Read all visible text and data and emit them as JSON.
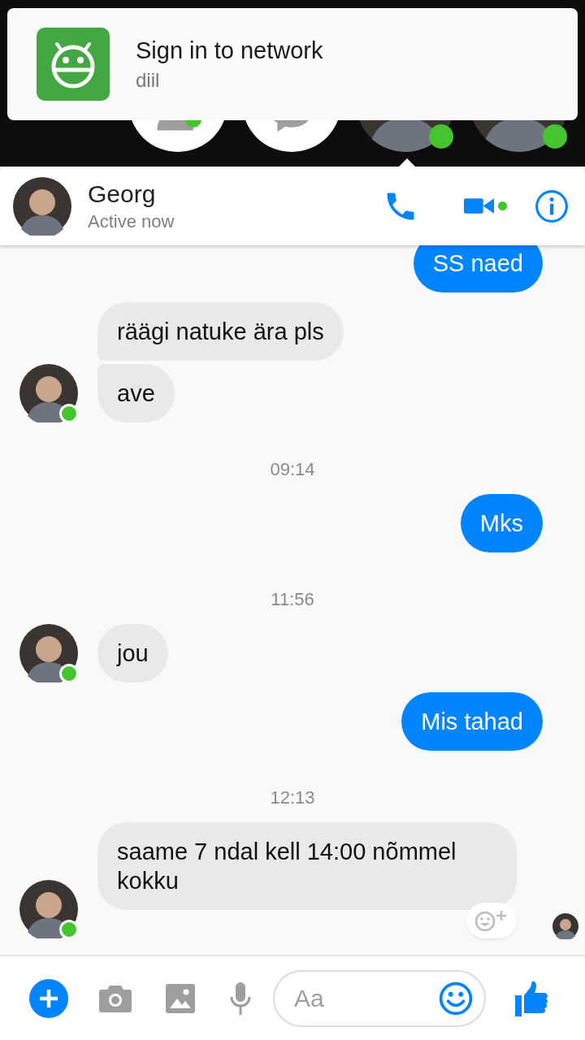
{
  "notification": {
    "title": "Sign in to network",
    "subtitle": "diil"
  },
  "chat_heads": [
    {
      "kind": "contacts",
      "online": true
    },
    {
      "kind": "messenger",
      "online": false
    },
    {
      "kind": "avatar",
      "online": true
    },
    {
      "kind": "avatar",
      "online": true
    }
  ],
  "header": {
    "name": "Georg",
    "status": "Active now",
    "video_active": true
  },
  "messages": [
    {
      "kind": "outgoing",
      "text": "SS naed"
    },
    {
      "kind": "incoming",
      "text": "räägi natuke ära pls",
      "online": false
    },
    {
      "kind": "incoming",
      "text": "ave",
      "online": true
    },
    {
      "kind": "time",
      "text": "09:14"
    },
    {
      "kind": "outgoing",
      "text": "Mks"
    },
    {
      "kind": "time",
      "text": "11:56"
    },
    {
      "kind": "incoming",
      "text": "jou",
      "online": true
    },
    {
      "kind": "outgoing",
      "text": "Mis tahad"
    },
    {
      "kind": "time",
      "text": "12:13"
    },
    {
      "kind": "incoming",
      "text": "saame 7 ndal kell 14:00 nõmmel kokku",
      "online": true,
      "reaction_button": true,
      "seen": true
    }
  ],
  "composer": {
    "placeholder": "Aa"
  }
}
